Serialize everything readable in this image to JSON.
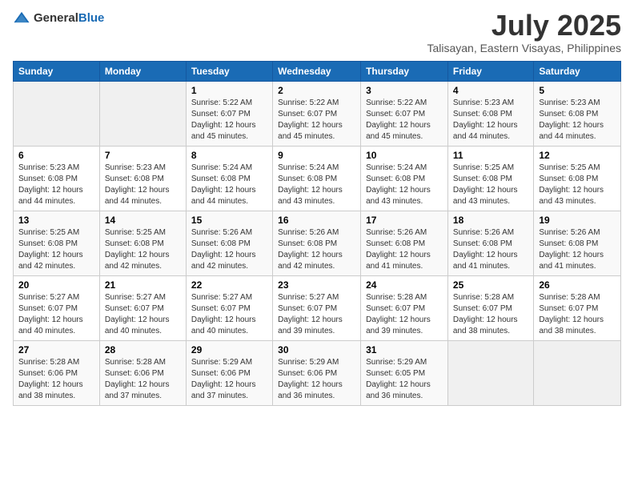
{
  "logo": {
    "general": "General",
    "blue": "Blue"
  },
  "title": "July 2025",
  "subtitle": "Talisayan, Eastern Visayas, Philippines",
  "headers": [
    "Sunday",
    "Monday",
    "Tuesday",
    "Wednesday",
    "Thursday",
    "Friday",
    "Saturday"
  ],
  "weeks": [
    [
      {
        "day": "",
        "info": ""
      },
      {
        "day": "",
        "info": ""
      },
      {
        "day": "1",
        "info": "Sunrise: 5:22 AM\nSunset: 6:07 PM\nDaylight: 12 hours and 45 minutes."
      },
      {
        "day": "2",
        "info": "Sunrise: 5:22 AM\nSunset: 6:07 PM\nDaylight: 12 hours and 45 minutes."
      },
      {
        "day": "3",
        "info": "Sunrise: 5:22 AM\nSunset: 6:07 PM\nDaylight: 12 hours and 45 minutes."
      },
      {
        "day": "4",
        "info": "Sunrise: 5:23 AM\nSunset: 6:08 PM\nDaylight: 12 hours and 44 minutes."
      },
      {
        "day": "5",
        "info": "Sunrise: 5:23 AM\nSunset: 6:08 PM\nDaylight: 12 hours and 44 minutes."
      }
    ],
    [
      {
        "day": "6",
        "info": "Sunrise: 5:23 AM\nSunset: 6:08 PM\nDaylight: 12 hours and 44 minutes."
      },
      {
        "day": "7",
        "info": "Sunrise: 5:23 AM\nSunset: 6:08 PM\nDaylight: 12 hours and 44 minutes."
      },
      {
        "day": "8",
        "info": "Sunrise: 5:24 AM\nSunset: 6:08 PM\nDaylight: 12 hours and 44 minutes."
      },
      {
        "day": "9",
        "info": "Sunrise: 5:24 AM\nSunset: 6:08 PM\nDaylight: 12 hours and 43 minutes."
      },
      {
        "day": "10",
        "info": "Sunrise: 5:24 AM\nSunset: 6:08 PM\nDaylight: 12 hours and 43 minutes."
      },
      {
        "day": "11",
        "info": "Sunrise: 5:25 AM\nSunset: 6:08 PM\nDaylight: 12 hours and 43 minutes."
      },
      {
        "day": "12",
        "info": "Sunrise: 5:25 AM\nSunset: 6:08 PM\nDaylight: 12 hours and 43 minutes."
      }
    ],
    [
      {
        "day": "13",
        "info": "Sunrise: 5:25 AM\nSunset: 6:08 PM\nDaylight: 12 hours and 42 minutes."
      },
      {
        "day": "14",
        "info": "Sunrise: 5:25 AM\nSunset: 6:08 PM\nDaylight: 12 hours and 42 minutes."
      },
      {
        "day": "15",
        "info": "Sunrise: 5:26 AM\nSunset: 6:08 PM\nDaylight: 12 hours and 42 minutes."
      },
      {
        "day": "16",
        "info": "Sunrise: 5:26 AM\nSunset: 6:08 PM\nDaylight: 12 hours and 42 minutes."
      },
      {
        "day": "17",
        "info": "Sunrise: 5:26 AM\nSunset: 6:08 PM\nDaylight: 12 hours and 41 minutes."
      },
      {
        "day": "18",
        "info": "Sunrise: 5:26 AM\nSunset: 6:08 PM\nDaylight: 12 hours and 41 minutes."
      },
      {
        "day": "19",
        "info": "Sunrise: 5:26 AM\nSunset: 6:08 PM\nDaylight: 12 hours and 41 minutes."
      }
    ],
    [
      {
        "day": "20",
        "info": "Sunrise: 5:27 AM\nSunset: 6:07 PM\nDaylight: 12 hours and 40 minutes."
      },
      {
        "day": "21",
        "info": "Sunrise: 5:27 AM\nSunset: 6:07 PM\nDaylight: 12 hours and 40 minutes."
      },
      {
        "day": "22",
        "info": "Sunrise: 5:27 AM\nSunset: 6:07 PM\nDaylight: 12 hours and 40 minutes."
      },
      {
        "day": "23",
        "info": "Sunrise: 5:27 AM\nSunset: 6:07 PM\nDaylight: 12 hours and 39 minutes."
      },
      {
        "day": "24",
        "info": "Sunrise: 5:28 AM\nSunset: 6:07 PM\nDaylight: 12 hours and 39 minutes."
      },
      {
        "day": "25",
        "info": "Sunrise: 5:28 AM\nSunset: 6:07 PM\nDaylight: 12 hours and 38 minutes."
      },
      {
        "day": "26",
        "info": "Sunrise: 5:28 AM\nSunset: 6:07 PM\nDaylight: 12 hours and 38 minutes."
      }
    ],
    [
      {
        "day": "27",
        "info": "Sunrise: 5:28 AM\nSunset: 6:06 PM\nDaylight: 12 hours and 38 minutes."
      },
      {
        "day": "28",
        "info": "Sunrise: 5:28 AM\nSunset: 6:06 PM\nDaylight: 12 hours and 37 minutes."
      },
      {
        "day": "29",
        "info": "Sunrise: 5:29 AM\nSunset: 6:06 PM\nDaylight: 12 hours and 37 minutes."
      },
      {
        "day": "30",
        "info": "Sunrise: 5:29 AM\nSunset: 6:06 PM\nDaylight: 12 hours and 36 minutes."
      },
      {
        "day": "31",
        "info": "Sunrise: 5:29 AM\nSunset: 6:05 PM\nDaylight: 12 hours and 36 minutes."
      },
      {
        "day": "",
        "info": ""
      },
      {
        "day": "",
        "info": ""
      }
    ]
  ]
}
